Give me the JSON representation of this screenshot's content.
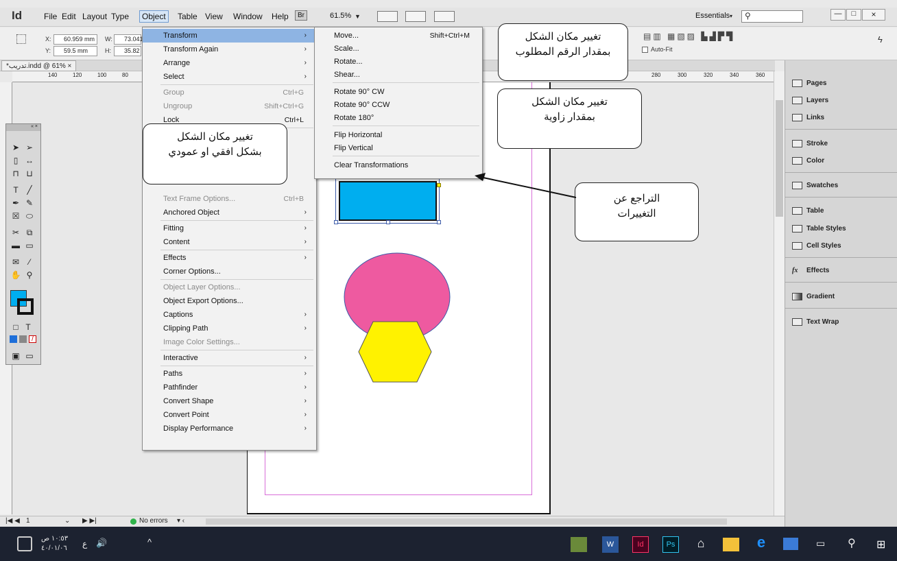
{
  "app": {
    "logo": "Id"
  },
  "menubar": {
    "items": [
      "File",
      "Edit",
      "Layout",
      "Type",
      "Object",
      "Table",
      "View",
      "Window",
      "Help"
    ],
    "bridge": "Br",
    "zoom": "61.5%",
    "workspace": "Essentials",
    "window_controls": [
      "—",
      "□",
      "×"
    ]
  },
  "control": {
    "x_label": "X:",
    "x_value": "60.959 mm",
    "y_label": "Y:",
    "y_value": "59.5 mm",
    "w_label": "W:",
    "w_value": "73.041",
    "h_label": "H:",
    "h_value": "35.82",
    "autofit": "Auto-Fit"
  },
  "document": {
    "tab": "*تدريب.indd @ 61% ×",
    "ruler_marks": [
      "140",
      "120",
      "100",
      "80",
      "280",
      "300",
      "320",
      "340",
      "360"
    ]
  },
  "object_menu": {
    "items": [
      {
        "label": "Transform",
        "shortcut": "",
        "submenu": true,
        "disabled": false,
        "highlight": true
      },
      {
        "label": "Transform Again",
        "shortcut": "",
        "submenu": true,
        "disabled": false
      },
      {
        "label": "Arrange",
        "shortcut": "",
        "submenu": true,
        "disabled": false
      },
      {
        "label": "Select",
        "shortcut": "",
        "submenu": true,
        "disabled": false
      },
      {
        "label": "Group",
        "shortcut": "Ctrl+G",
        "submenu": false,
        "disabled": true
      },
      {
        "label": "Ungroup",
        "shortcut": "Shift+Ctrl+G",
        "submenu": false,
        "disabled": true
      },
      {
        "label": "Lock",
        "shortcut": "Ctrl+L",
        "submenu": false,
        "disabled": false
      },
      {
        "label": "Text Frame Options...",
        "shortcut": "Ctrl+B",
        "submenu": false,
        "disabled": true
      },
      {
        "label": "Anchored Object",
        "shortcut": "",
        "submenu": true,
        "disabled": false
      },
      {
        "label": "Fitting",
        "shortcut": "",
        "submenu": true,
        "disabled": false
      },
      {
        "label": "Content",
        "shortcut": "",
        "submenu": true,
        "disabled": false
      },
      {
        "label": "Effects",
        "shortcut": "",
        "submenu": true,
        "disabled": false
      },
      {
        "label": "Corner Options...",
        "shortcut": "",
        "submenu": false,
        "disabled": false
      },
      {
        "label": "Object Layer Options...",
        "shortcut": "",
        "submenu": false,
        "disabled": true
      },
      {
        "label": "Object Export Options...",
        "shortcut": "",
        "submenu": false,
        "disabled": false
      },
      {
        "label": "Captions",
        "shortcut": "",
        "submenu": true,
        "disabled": false
      },
      {
        "label": "Clipping Path",
        "shortcut": "",
        "submenu": true,
        "disabled": false
      },
      {
        "label": "Image Color Settings...",
        "shortcut": "",
        "submenu": false,
        "disabled": true
      },
      {
        "label": "Interactive",
        "shortcut": "",
        "submenu": true,
        "disabled": false
      },
      {
        "label": "Paths",
        "shortcut": "",
        "submenu": true,
        "disabled": false
      },
      {
        "label": "Pathfinder",
        "shortcut": "",
        "submenu": true,
        "disabled": false
      },
      {
        "label": "Convert Shape",
        "shortcut": "",
        "submenu": true,
        "disabled": false
      },
      {
        "label": "Convert Point",
        "shortcut": "",
        "submenu": true,
        "disabled": false
      },
      {
        "label": "Display Performance",
        "shortcut": "",
        "submenu": true,
        "disabled": false
      }
    ]
  },
  "transform_menu": {
    "items": [
      {
        "label": "Move...",
        "shortcut": "Shift+Ctrl+M"
      },
      {
        "label": "Scale...",
        "shortcut": ""
      },
      {
        "label": "Rotate...",
        "shortcut": ""
      },
      {
        "label": "Shear...",
        "shortcut": ""
      },
      {
        "label": "Rotate 90° CW",
        "shortcut": ""
      },
      {
        "label": "Rotate 90° CCW",
        "shortcut": ""
      },
      {
        "label": "Rotate 180°",
        "shortcut": ""
      },
      {
        "label": "Flip Horizontal",
        "shortcut": ""
      },
      {
        "label": "Flip Vertical",
        "shortcut": ""
      },
      {
        "label": "Clear Transformations",
        "shortcut": ""
      }
    ]
  },
  "callouts": {
    "move_line1": "تغيير مكان الشكل",
    "move_line2": "بمقدار الرقم المطلوب",
    "rotate_line1": "تغيير مكان الشكل",
    "rotate_line2": "بمقدار زاوية",
    "flip_line1": "تغيير مكان الشكل",
    "flip_line2": "بشكل افقي او عمودي",
    "clear_line1": "التراجع عن",
    "clear_line2": "التغييرات"
  },
  "panels": {
    "items": [
      "Pages",
      "Layers",
      "Links",
      "Stroke",
      "Color",
      "Swatches",
      "Table",
      "Table Styles",
      "Cell Styles",
      "Effects",
      "Gradient",
      "Text Wrap"
    ]
  },
  "status": {
    "page": "1",
    "errors": "No errors"
  },
  "shapes": {
    "rect_color": "#00aeef",
    "circle_color": "#ee5aa0",
    "hexagon_color": "#fff200"
  },
  "taskbar": {
    "time": "١٠:٥٣ ص",
    "date": "٤٠/٠١/٠٦",
    "lang": "ع",
    "apps": [
      "Word",
      "InDesign",
      "Photoshop",
      "Store",
      "Explorer",
      "Edge"
    ]
  }
}
